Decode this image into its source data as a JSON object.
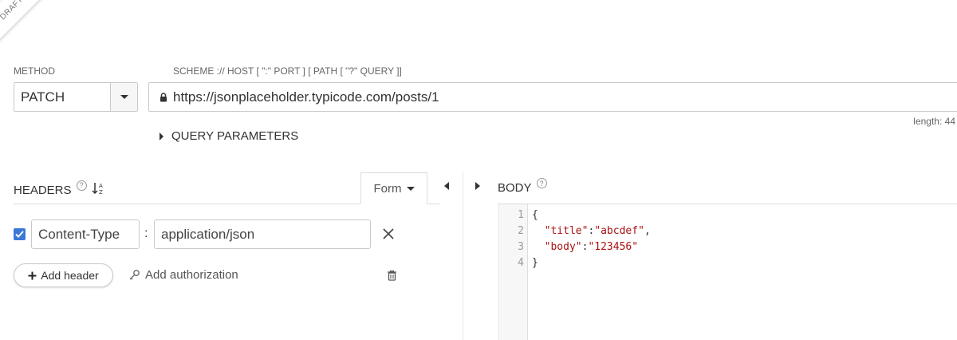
{
  "draft": {
    "ribbon_label": "DRAFT"
  },
  "request": {
    "method_label": "METHOD",
    "method_value": "PATCH",
    "url_hint": "SCHEME :// HOST [ \":\" PORT ] [ PATH [ \"?\" QUERY ]]",
    "url_value": "https://jsonplaceholder.typicode.com/posts/1",
    "length_text": "length: 44",
    "query_parameters_label": "QUERY PARAMETERS"
  },
  "headers": {
    "title": "HEADERS",
    "help_glyph": "?",
    "form_tab_label": "Form",
    "rows": [
      {
        "checked": true,
        "key": "Content-Type",
        "separator": ":",
        "value": "application/json"
      }
    ],
    "add_header_label": "Add header",
    "add_authorization_label": "Add authorization"
  },
  "body": {
    "title": "BODY",
    "help_glyph": "?",
    "line_numbers": [
      "1",
      "2",
      "3",
      "4"
    ],
    "lines": [
      {
        "pre": "{",
        "key": "",
        "mid": "",
        "val": "",
        "post": ""
      },
      {
        "pre": "  ",
        "key": "\"title\"",
        "mid": ":",
        "val": "\"abcdef\"",
        "post": ","
      },
      {
        "pre": "  ",
        "key": "\"body\"",
        "mid": ":",
        "val": "\"123456\"",
        "post": ""
      },
      {
        "pre": "}",
        "key": "",
        "mid": "",
        "val": "",
        "post": ""
      }
    ]
  },
  "colors": {
    "accent": "#3b78d8",
    "string": "#aa1111",
    "border": "#c9c9c9"
  }
}
